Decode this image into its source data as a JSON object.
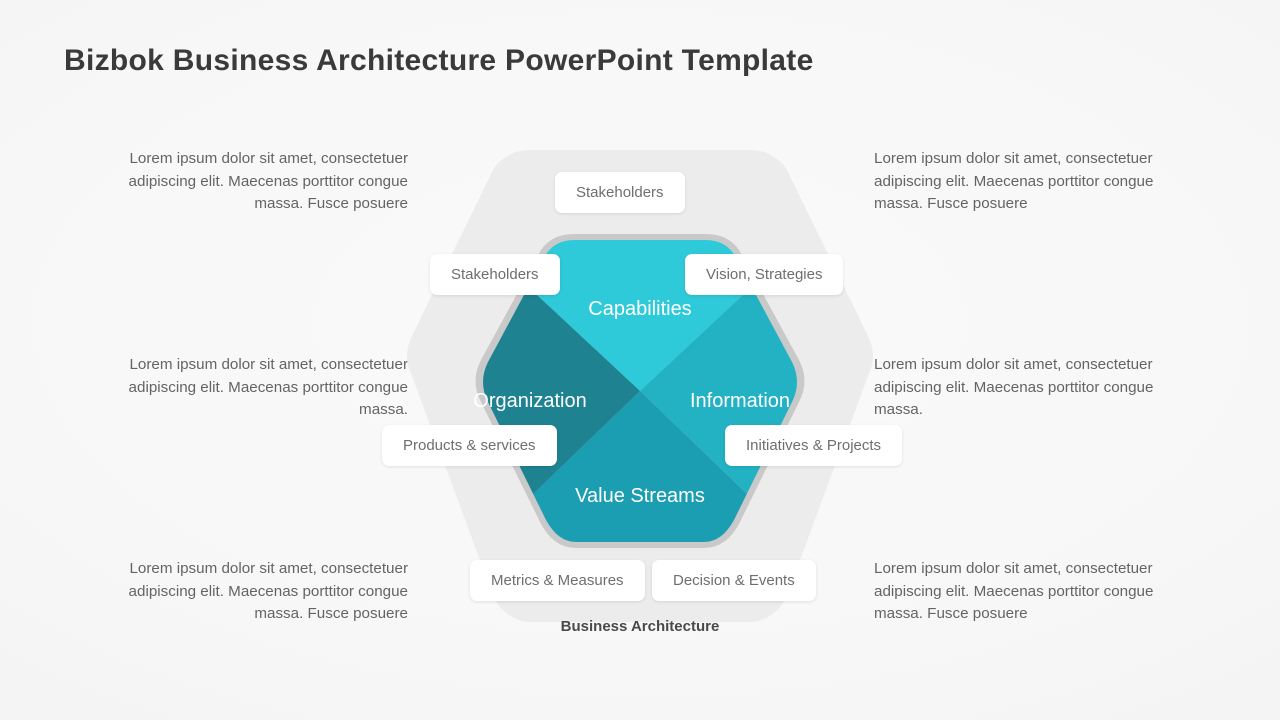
{
  "slide": {
    "title": "Bizbok Business Architecture PowerPoint Template",
    "caption": "Business Architecture"
  },
  "body_text": {
    "left": [
      "Lorem ipsum dolor sit amet, consectetuer adipiscing elit. Maecenas porttitor congue massa. Fusce posuere",
      "Lorem ipsum dolor sit amet, consectetuer adipiscing elit. Maecenas porttitor congue massa.",
      "Lorem ipsum dolor sit amet, consectetuer adipiscing elit. Maecenas porttitor congue massa. Fusce posuere"
    ],
    "right": [
      "Lorem ipsum dolor sit amet, consectetuer adipiscing elit. Maecenas porttitor congue massa. Fusce posuere",
      "Lorem ipsum dolor sit amet, consectetuer adipiscing elit. Maecenas porttitor congue massa.",
      "Lorem ipsum dolor sit amet, consectetuer adipiscing elit. Maecenas porttitor congue massa. Fusce posuere"
    ]
  },
  "diagram": {
    "quadrants": [
      {
        "id": "capabilities",
        "label": "Capabilities",
        "color": "#2ECAD9"
      },
      {
        "id": "information",
        "label": "Information",
        "color": "#22B2C4"
      },
      {
        "id": "value-streams",
        "label": "Value Streams",
        "color": "#1B9DB2"
      },
      {
        "id": "organization",
        "label": "Organization",
        "color": "#1E8291"
      }
    ],
    "pills": [
      {
        "id": "stakeholders-top",
        "label": "Stakeholders"
      },
      {
        "id": "stakeholders",
        "label": "Stakeholders"
      },
      {
        "id": "vision-strategies",
        "label": "Vision, Strategies"
      },
      {
        "id": "products-services",
        "label": "Products & services"
      },
      {
        "id": "initiatives-projects",
        "label": "Initiatives & Projects"
      },
      {
        "id": "metrics-measures",
        "label": "Metrics & Measures"
      },
      {
        "id": "decision-events",
        "label": "Decision & Events"
      }
    ],
    "colors": {
      "outer_hexagon": "#EDEDED",
      "inner_ring": "#CCCCCC",
      "background": "#F5F5F5",
      "title_text": "#3A3A3A",
      "body_text": "#646464",
      "pill_text": "#6E6E6E"
    }
  }
}
